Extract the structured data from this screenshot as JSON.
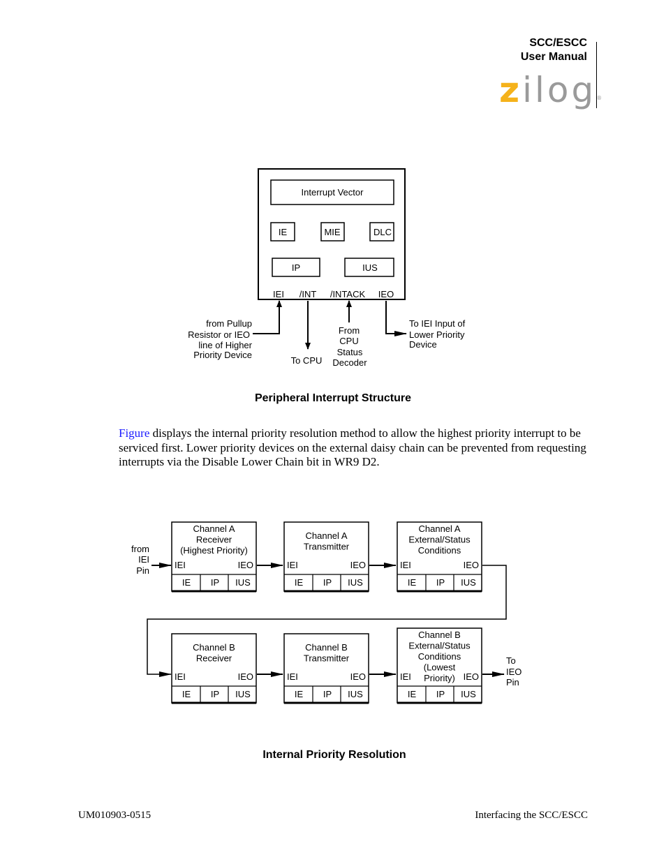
{
  "header": {
    "title_line1": "SCC/ESCC",
    "title_line2": "User Manual",
    "logo": {
      "first": "z",
      "rest": "ilog",
      "reg": "®",
      "accent_color": "#f5b21b",
      "grey_color": "#9a9a9a"
    }
  },
  "figure1": {
    "blocks": {
      "vector": "Interrupt Vector",
      "ie": "IE",
      "mie": "MIE",
      "dlc": "DLC",
      "ip": "IP",
      "ius": "IUS"
    },
    "pins": {
      "iei": "IEI",
      "int": "/INT",
      "intack": "/INTACK",
      "ieo": "IEO"
    },
    "labels": {
      "pullup": [
        "from Pullup",
        "Resistor or IEO",
        "line of Higher",
        "Priority Device"
      ],
      "to_cpu": "To CPU",
      "from_cpu": [
        "From",
        "CPU",
        "Status",
        "Decoder"
      ],
      "to_iei": [
        "To IEI Input of",
        "Lower Priority",
        "Device"
      ]
    },
    "caption": "Peripheral Interrupt Structure"
  },
  "paragraph": {
    "link": "Figure",
    "text": " displays the internal priority resolution method to allow the highest priority interrupt to be serviced first. Lower priority devices on the external daisy chain can be prevented from requesting interrupts via the Disable Lower Chain bit in WR9 D2."
  },
  "figure2": {
    "channels": [
      {
        "title": [
          "Channel A",
          "Receiver",
          "(Highest Priority)"
        ]
      },
      {
        "title": [
          "Channel A",
          "Transmitter"
        ]
      },
      {
        "title": [
          "Channel A",
          "External/Status",
          "Conditions"
        ]
      },
      {
        "title": [
          "Channel B",
          "Receiver"
        ]
      },
      {
        "title": [
          "Channel B",
          "Transmitter"
        ]
      },
      {
        "title": [
          "Channel B",
          "External/Status",
          "Conditions",
          "(Lowest",
          "Priority)"
        ]
      }
    ],
    "pin_in": "IEI",
    "pin_out": "IEO",
    "cells": [
      "IE",
      "IP",
      "IUS"
    ],
    "from_label": [
      "from",
      "IEI",
      "Pin"
    ],
    "to_label": [
      "To",
      "IEO",
      "Pin"
    ],
    "caption": "Internal Priority Resolution"
  },
  "footer": {
    "left": "UM010903-0515",
    "right": "Interfacing the SCC/ESCC"
  }
}
